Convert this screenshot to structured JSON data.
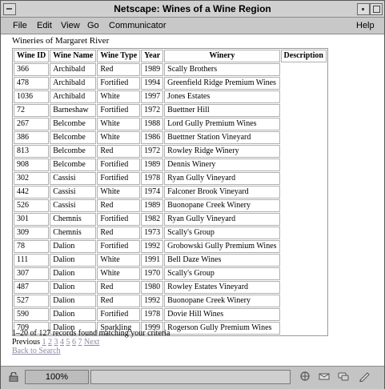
{
  "window": {
    "title": "Netscape: Wines of a Wine Region"
  },
  "menubar": {
    "file": "File",
    "edit": "Edit",
    "view": "View",
    "go": "Go",
    "communicator": "Communicator",
    "help": "Help"
  },
  "page": {
    "section_title": "Wineries of Margaret River",
    "table": {
      "headers": [
        "Wine ID",
        "Wine Name",
        "Wine Type",
        "Year",
        "Winery",
        "Description"
      ],
      "rows": [
        [
          "366",
          "Archibald",
          "Red",
          "1989",
          "Scally Brothers"
        ],
        [
          "478",
          "Archibald",
          "Fortified",
          "1994",
          "Greenfield Ridge Premium Wines"
        ],
        [
          "1036",
          "Archibald",
          "White",
          "1997",
          "Jones Estates"
        ],
        [
          "72",
          "Barneshaw",
          "Fortified",
          "1972",
          "Buettner Hill"
        ],
        [
          "267",
          "Belcombe",
          "White",
          "1988",
          "Lord Gully Premium Wines"
        ],
        [
          "386",
          "Belcombe",
          "White",
          "1986",
          "Buettner Station Vineyard"
        ],
        [
          "813",
          "Belcombe",
          "Red",
          "1972",
          "Rowley Ridge Winery"
        ],
        [
          "908",
          "Belcombe",
          "Fortified",
          "1989",
          "Dennis Winery"
        ],
        [
          "302",
          "Cassisi",
          "Fortified",
          "1978",
          "Ryan Gully Vineyard"
        ],
        [
          "442",
          "Cassisi",
          "White",
          "1974",
          "Falconer Brook Vineyard"
        ],
        [
          "526",
          "Cassisi",
          "Red",
          "1989",
          "Buonopane Creek Winery"
        ],
        [
          "301",
          "Chemnis",
          "Fortified",
          "1982",
          "Ryan Gully Vineyard"
        ],
        [
          "309",
          "Chemnis",
          "Red",
          "1973",
          "Scally's Group"
        ],
        [
          "78",
          "Dalion",
          "Fortified",
          "1992",
          "Grobowski Gully Premium Wines"
        ],
        [
          "111",
          "Dalion",
          "White",
          "1991",
          "Bell Daze Wines"
        ],
        [
          "307",
          "Dalion",
          "White",
          "1970",
          "Scally's Group"
        ],
        [
          "487",
          "Dalion",
          "Red",
          "1980",
          "Rowley Estates Vineyard"
        ],
        [
          "527",
          "Dalion",
          "Red",
          "1992",
          "Buonopane Creek Winery"
        ],
        [
          "590",
          "Dalion",
          "Fortified",
          "1978",
          "Dovie Hill Wines"
        ],
        [
          "709",
          "Dalion",
          "Sparkling",
          "1999",
          "Rogerson Gully Premium Wines"
        ]
      ]
    },
    "records_text": "1–20 of 127 records found matching your criteria",
    "pager": {
      "previous": "Previous",
      "pages": [
        "1",
        "2",
        "3",
        "4",
        "5",
        "6",
        "7"
      ],
      "next": "Next"
    },
    "back_link": "Back to Search"
  },
  "statusbar": {
    "zoom": "100%",
    "status_text": ""
  },
  "colors": {
    "link_visited": "#8a8aa8",
    "chrome": "#c0c0c0",
    "content_bg": "#ffffff"
  },
  "icons": [
    "window-menu-icon",
    "minimize-icon",
    "maximize-icon",
    "security-lock-icon",
    "navigator-icon",
    "mail-icon",
    "discussion-icon",
    "composer-icon"
  ]
}
